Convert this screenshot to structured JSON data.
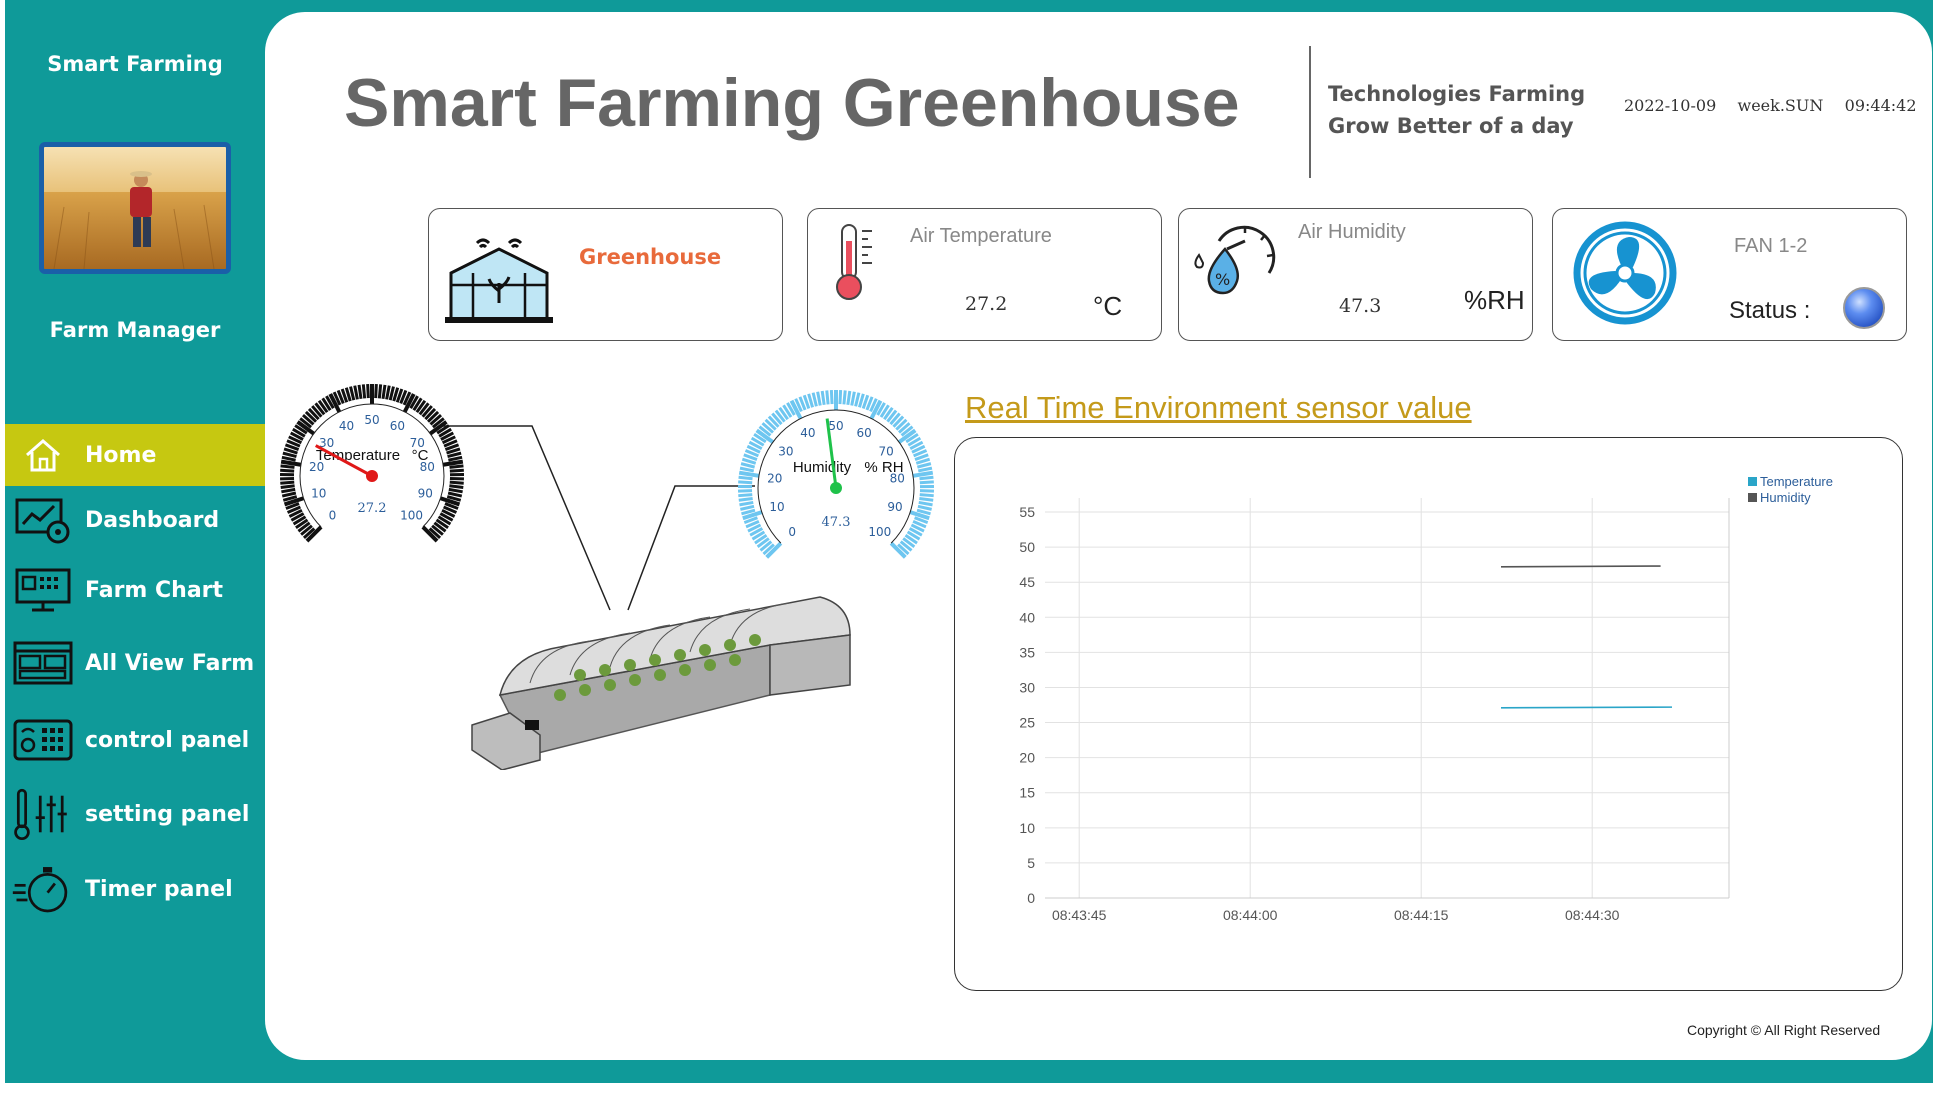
{
  "sidebar": {
    "brand": "Smart Farming",
    "manager": "Farm Manager",
    "items": [
      {
        "label": "Home"
      },
      {
        "label": "Dashboard"
      },
      {
        "label": "Farm Chart"
      },
      {
        "label": "All View Farm"
      },
      {
        "label": "control panel"
      },
      {
        "label": "setting panel"
      },
      {
        "label": "Timer panel"
      }
    ]
  },
  "header": {
    "title": "Smart Farming Greenhouse",
    "tagline_1": "Technologies Farming",
    "tagline_2": "Grow Better of a day",
    "date": "2022-10-09",
    "week": "week.SUN",
    "time": "09:44:42"
  },
  "cards": {
    "greenhouse": {
      "label": "Greenhouse",
      "icon": "greenhouse-icon"
    },
    "air_temp": {
      "label": "Air Temperature",
      "value": "27.2",
      "unit": "°C",
      "icon": "thermometer-icon"
    },
    "air_hum": {
      "label": "Air Humidity",
      "value": "47.3",
      "unit": "%RH",
      "icon": "humidity-icon"
    },
    "fan": {
      "label": "FAN 1-2",
      "status_label": "Status :",
      "icon": "fan-icon",
      "status_color": "#3b6fe0"
    }
  },
  "gauges": {
    "temperature": {
      "label": "Temperature",
      "unit": "°C",
      "value": 27.2,
      "value_text": "27.2",
      "min": 0,
      "max": 100,
      "ticks": [
        "0",
        "10",
        "20",
        "30",
        "40",
        "50",
        "60",
        "70",
        "80",
        "90",
        "100"
      ]
    },
    "humidity": {
      "label": "Humidity",
      "unit": "% RH",
      "value": 47.3,
      "value_text": "47.3",
      "min": 0,
      "max": 100,
      "ticks": [
        "0",
        "10",
        "20",
        "30",
        "40",
        "50",
        "60",
        "70",
        "80",
        "90",
        "100"
      ]
    }
  },
  "chart_section": {
    "title": "Real Time Environment sensor value"
  },
  "chart_data": {
    "type": "line",
    "x_ticks": [
      "08:43:45",
      "08:44:00",
      "08:44:15",
      "08:44:30"
    ],
    "xlim": [
      "08:43:42",
      "08:44:42"
    ],
    "ylim": [
      0,
      57
    ],
    "y_ticks": [
      0,
      5,
      10,
      15,
      20,
      25,
      30,
      35,
      40,
      45,
      50,
      55
    ],
    "grid": true,
    "legend_position": "top-right",
    "series": [
      {
        "name": "Temperature",
        "color": "#2aa5c8",
        "x": [
          "08:44:22",
          "08:44:37"
        ],
        "y": [
          27.1,
          27.2
        ]
      },
      {
        "name": "Humidity",
        "color": "#555555",
        "x": [
          "08:44:22",
          "08:44:36"
        ],
        "y": [
          47.2,
          47.3
        ]
      }
    ]
  },
  "footer": {
    "copyright": "Copyright © All Right Reserved"
  }
}
